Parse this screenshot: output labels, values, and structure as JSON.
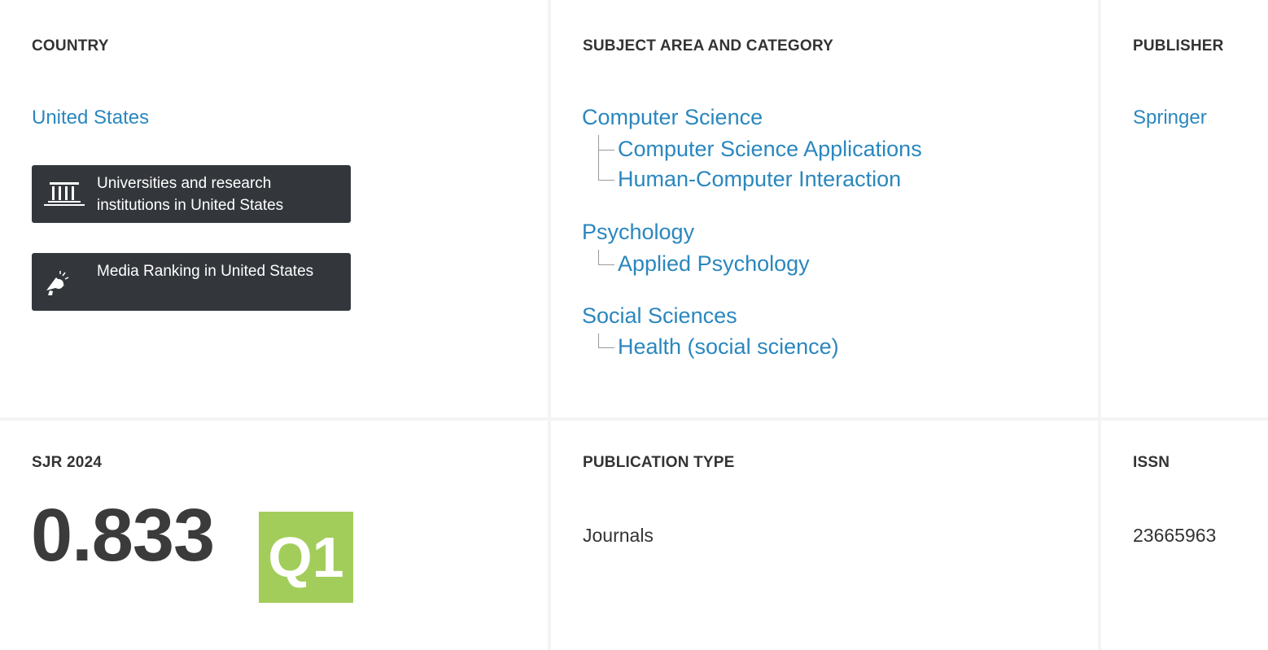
{
  "country": {
    "heading": "COUNTRY",
    "name": "United States",
    "universities_button": "Universities and research institutions in United States",
    "media_button": "Media Ranking in United States"
  },
  "subject": {
    "heading": "SUBJECT AREA AND CATEGORY",
    "areas": [
      {
        "name": "Computer Science",
        "categories": [
          "Computer Science Applications",
          "Human-Computer Interaction"
        ]
      },
      {
        "name": "Psychology",
        "categories": [
          "Applied Psychology"
        ]
      },
      {
        "name": "Social Sciences",
        "categories": [
          "Health (social science)"
        ]
      }
    ]
  },
  "publisher": {
    "heading": "PUBLISHER",
    "name": "Springer"
  },
  "sjr": {
    "heading": "SJR 2024",
    "value": "0.833",
    "quartile": "Q1",
    "quartile_color": "#a2cd5a"
  },
  "publication_type": {
    "heading": "PUBLICATION TYPE",
    "value": "Journals"
  },
  "issn": {
    "heading": "ISSN",
    "value": "23665963"
  },
  "colors": {
    "link": "#2a87be",
    "button_bg": "#33373c"
  },
  "icons": {
    "universities": "institution-icon",
    "media": "megaphone-icon"
  }
}
